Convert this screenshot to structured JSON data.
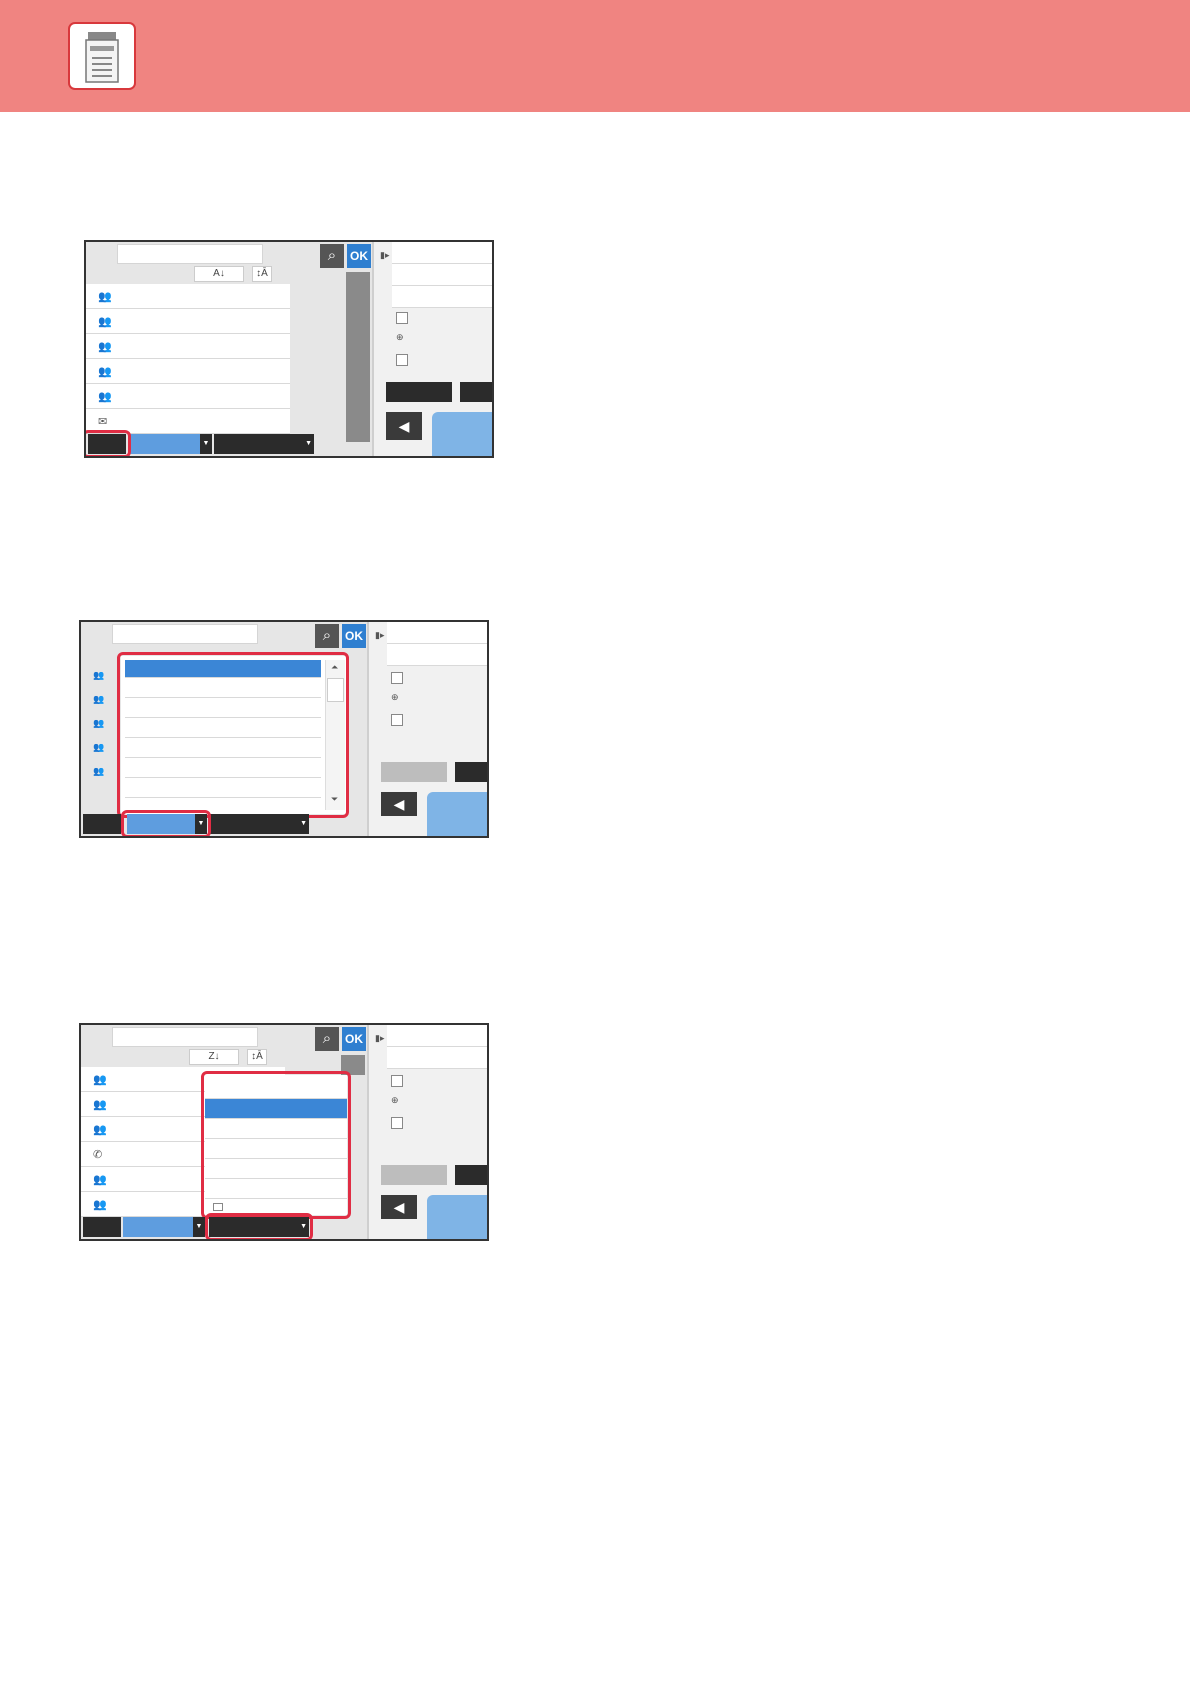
{
  "icons": {
    "logo": "printer-icon",
    "search": "search-icon",
    "ok": "OK",
    "group": "group-icon",
    "phone": "phone-icon",
    "speaker": "speaker-icon"
  },
  "screen1": {
    "ok_label": "OK",
    "sort_label": "A↓",
    "sort2_label": "↕Ā"
  },
  "screen2": {
    "ok_label": "OK"
  },
  "screen3": {
    "ok_label": "OK",
    "sort_label": "Z↓",
    "sort2_label": "↕Ā"
  },
  "colors": {
    "header": "#f08481",
    "highlight": "#e02d44",
    "ok_button": "#2f7fd0",
    "selected": "#3b86d6"
  }
}
